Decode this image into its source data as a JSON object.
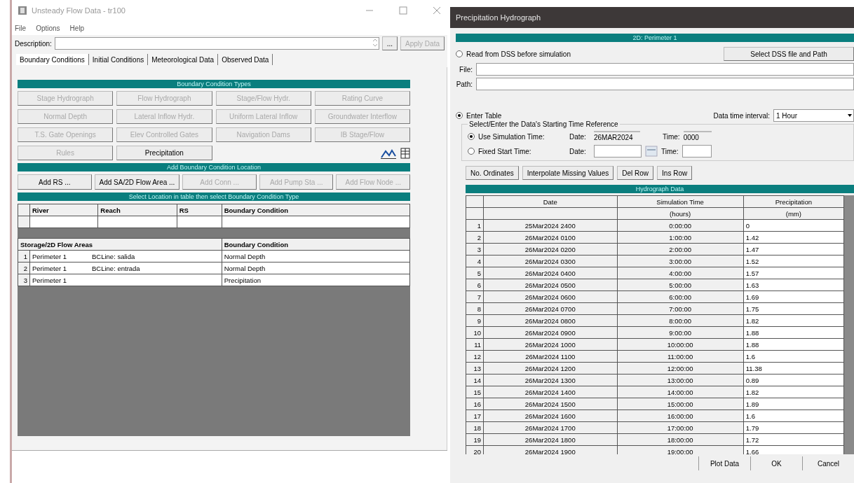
{
  "main_window": {
    "title": "Unsteady Flow Data - tr100",
    "menu": [
      "File",
      "Options",
      "Help"
    ],
    "description": {
      "label": "Description:",
      "browse_button": "...",
      "apply_button": {
        "label": "Apply Data",
        "disabled": true
      }
    },
    "tabs": [
      {
        "label": "Boundary Conditions",
        "selected": true
      },
      {
        "label": "Initial Conditions",
        "selected": false
      },
      {
        "label": "Meteorological Data",
        "selected": false
      },
      {
        "label": "Observed Data",
        "selected": false
      }
    ],
    "bc_types": {
      "header": "Boundary Condition Types",
      "buttons": [
        {
          "label": "Stage Hydrograph",
          "disabled": true
        },
        {
          "label": "Flow Hydrograph",
          "disabled": true
        },
        {
          "label": "Stage/Flow Hydr.",
          "disabled": true
        },
        {
          "label": "Rating Curve",
          "disabled": true
        },
        {
          "label": "Normal Depth",
          "disabled": true
        },
        {
          "label": "Lateral Inflow Hydr.",
          "disabled": true
        },
        {
          "label": "Uniform Lateral Inflow",
          "disabled": true
        },
        {
          "label": "Groundwater Interflow",
          "disabled": true
        },
        {
          "label": "T.S. Gate Openings",
          "disabled": true
        },
        {
          "label": "Elev Controlled Gates",
          "disabled": true
        },
        {
          "label": "Navigation Dams",
          "disabled": true
        },
        {
          "label": "IB Stage/Flow",
          "disabled": true
        },
        {
          "label": "Rules",
          "disabled": true
        },
        {
          "label": "Precipitation",
          "disabled": false
        }
      ]
    },
    "add_location": {
      "header": "Add Boundary Condition Location",
      "buttons": [
        {
          "label": "Add RS ...",
          "disabled": false
        },
        {
          "label": "Add SA/2D Flow Area ...",
          "disabled": false
        },
        {
          "label": "Add Conn ...",
          "disabled": true
        },
        {
          "label": "Add Pump Sta ...",
          "disabled": true
        },
        {
          "label": "Add Flow Node ...",
          "disabled": true
        }
      ]
    },
    "location_table": {
      "header": "Select Location in table then select Boundary Condition Type",
      "columns": [
        "River",
        "Reach",
        "RS",
        "Boundary Condition"
      ],
      "storage_columns": [
        "Storage/2D Flow Areas",
        "Boundary Condition"
      ],
      "storage_rows": [
        {
          "index": "1",
          "area": "Perimeter 1",
          "bc_line": "BCLine: salida",
          "boundary_condition": "Normal Depth"
        },
        {
          "index": "2",
          "area": "Perimeter 1",
          "bc_line": "BCLine: entrada",
          "boundary_condition": "Normal Depth"
        },
        {
          "index": "3",
          "area": "Perimeter 1",
          "boundary_condition": "Precipitation"
        }
      ]
    }
  },
  "dialog": {
    "title": "Precipitation Hydrograph",
    "location_header": "2D: Perimeter 1",
    "dss": {
      "label": "Read from DSS before simulation",
      "selected": false,
      "button": "Select DSS file and Path",
      "file_label": "File:",
      "path_label": "Path:"
    },
    "enter_table": {
      "label": "Enter Table",
      "selected": true
    },
    "interval": {
      "label": "Data time interval:",
      "value": "1 Hour"
    },
    "time_ref": {
      "legend": "Select/Enter the Data's Starting Time Reference",
      "options": [
        {
          "label": "Use Simulation Time:",
          "selected": true,
          "date_label": "Date:",
          "date": "26MAR2024",
          "time_label": "Time:",
          "time": "0000"
        },
        {
          "label": "Fixed Start Time:",
          "selected": false,
          "date_label": "Date:",
          "time_label": "Time:"
        }
      ]
    },
    "table_buttons": [
      "No. Ordinates",
      "Interpolate Missing Values",
      "Del Row",
      "Ins Row"
    ],
    "table": {
      "header": "Hydrograph Data",
      "columns": [
        {
          "name": "Date"
        },
        {
          "name": "Simulation Time",
          "unit": "(hours)"
        },
        {
          "name": "Precipitation",
          "unit": "(mm)"
        }
      ],
      "rows": [
        {
          "index": "1",
          "date": "25Mar2024 2400",
          "time": "0:00:00",
          "value": "0"
        },
        {
          "index": "2",
          "date": "26Mar2024 0100",
          "time": "1:00:00",
          "value": "1.42"
        },
        {
          "index": "3",
          "date": "26Mar2024 0200",
          "time": "2:00:00",
          "value": "1.47"
        },
        {
          "index": "4",
          "date": "26Mar2024 0300",
          "time": "3:00:00",
          "value": "1.52"
        },
        {
          "index": "5",
          "date": "26Mar2024 0400",
          "time": "4:00:00",
          "value": "1.57"
        },
        {
          "index": "6",
          "date": "26Mar2024 0500",
          "time": "5:00:00",
          "value": "1.63"
        },
        {
          "index": "7",
          "date": "26Mar2024 0600",
          "time": "6:00:00",
          "value": "1.69"
        },
        {
          "index": "8",
          "date": "26Mar2024 0700",
          "time": "7:00:00",
          "value": "1.75"
        },
        {
          "index": "9",
          "date": "26Mar2024 0800",
          "time": "8:00:00",
          "value": "1.82"
        },
        {
          "index": "10",
          "date": "26Mar2024 0900",
          "time": "9:00:00",
          "value": "1.88"
        },
        {
          "index": "11",
          "date": "26Mar2024 1000",
          "time": "10:00:00",
          "value": "1.88"
        },
        {
          "index": "12",
          "date": "26Mar2024 1100",
          "time": "11:00:00",
          "value": "1.6"
        },
        {
          "index": "13",
          "date": "26Mar2024 1200",
          "time": "12:00:00",
          "value": "11.38"
        },
        {
          "index": "14",
          "date": "26Mar2024 1300",
          "time": "13:00:00",
          "value": "0.89"
        },
        {
          "index": "15",
          "date": "26Mar2024 1400",
          "time": "14:00:00",
          "value": "1.82"
        },
        {
          "index": "16",
          "date": "26Mar2024 1500",
          "time": "15:00:00",
          "value": "1.89"
        },
        {
          "index": "17",
          "date": "26Mar2024 1600",
          "time": "16:00:00",
          "value": "1.6"
        },
        {
          "index": "18",
          "date": "26Mar2024 1700",
          "time": "17:00:00",
          "value": "1.79"
        },
        {
          "index": "19",
          "date": "26Mar2024 1800",
          "time": "18:00:00",
          "value": "1.72"
        },
        {
          "index": "20",
          "date": "26Mar2024 1900",
          "time": "19:00:00",
          "value": "1.66"
        }
      ]
    },
    "buttons": [
      "Plot Data",
      "OK",
      "Cancel"
    ]
  }
}
